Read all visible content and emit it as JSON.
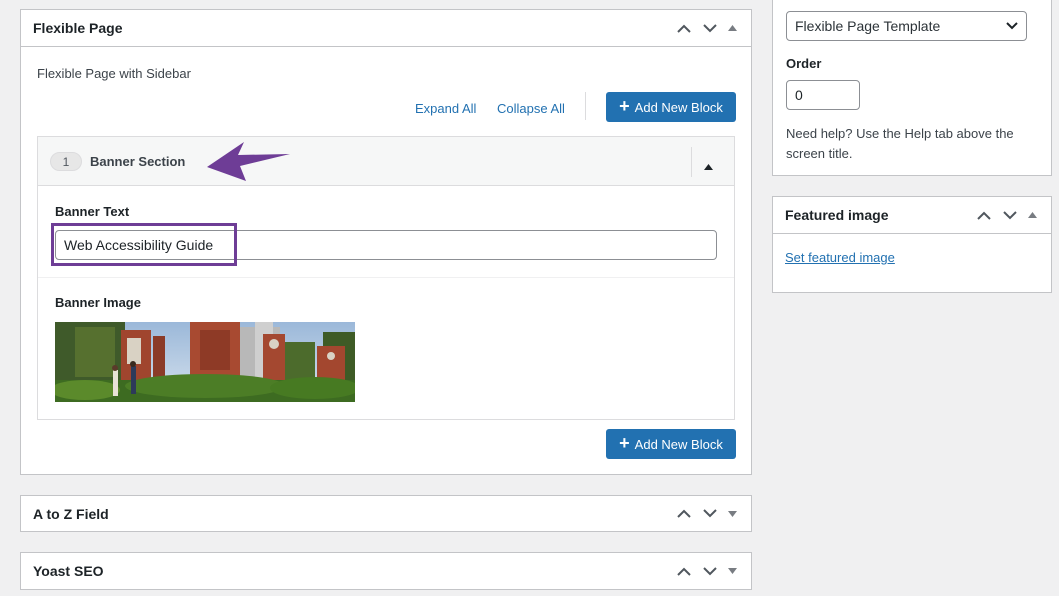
{
  "flexible_page": {
    "title": "Flexible Page",
    "template_name": "Flexible Page with Sidebar",
    "expand_all": "Expand All",
    "collapse_all": "Collapse All",
    "add_block_label": "Add New Block",
    "block": {
      "number": "1",
      "title": "Banner Section",
      "banner_text_label": "Banner Text",
      "banner_text_value": "Web Accessibility Guide",
      "banner_image_label": "Banner Image"
    }
  },
  "a_to_z": {
    "title": "A to Z Field"
  },
  "yoast": {
    "title": "Yoast SEO"
  },
  "attributes": {
    "template_selected": "Flexible Page Template",
    "order_label": "Order",
    "order_value": "0",
    "help_text": "Need help? Use the Help tab above the screen title."
  },
  "featured_image": {
    "title": "Featured image",
    "set_link": "Set featured image"
  },
  "colors": {
    "primary": "#2271b1",
    "annotation": "#6e3d96"
  }
}
